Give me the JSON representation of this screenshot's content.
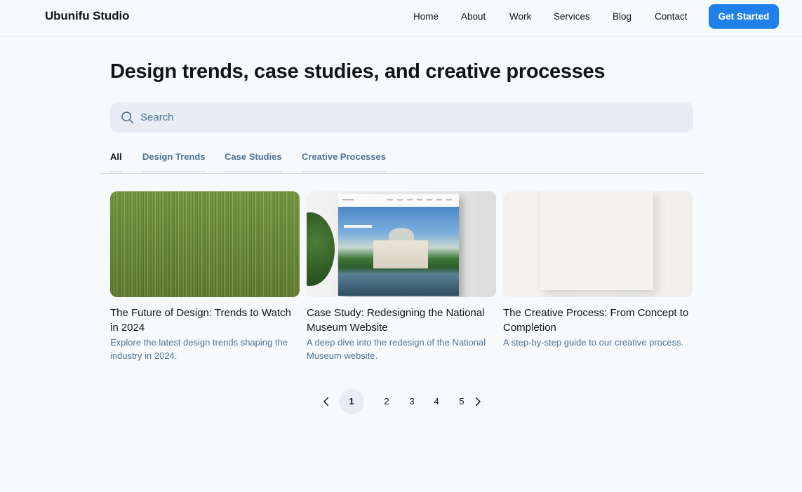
{
  "brand": "Ubunifu Studio",
  "nav": {
    "items": [
      "Home",
      "About",
      "Work",
      "Services",
      "Blog",
      "Contact"
    ],
    "cta": "Get Started"
  },
  "page": {
    "title": "Design trends, case studies, and creative processes"
  },
  "search": {
    "placeholder": "Search",
    "icon": "search-icon"
  },
  "tabs": [
    "All",
    "Design Trends",
    "Case Studies",
    "Creative Processes"
  ],
  "active_tab": "All",
  "cards": [
    {
      "title": "The Future of Design: Trends to Watch in 2024",
      "description": "Explore the latest design trends shaping the industry in 2024."
    },
    {
      "title": "Case Study: Redesigning the National Museum Website",
      "description": "A deep dive into the redesign of the National Museum website."
    },
    {
      "title": "The Creative Process: From Concept to Completion",
      "description": "A step-by-step guide to our creative process."
    }
  ],
  "pagination": {
    "pages": [
      "1",
      "2",
      "3",
      "4",
      "5"
    ],
    "current": "1"
  },
  "colors": {
    "background": "#f7fafc",
    "accent": "#1f80e9",
    "muted_text": "#4e7397",
    "surface": "#e7edf3"
  }
}
